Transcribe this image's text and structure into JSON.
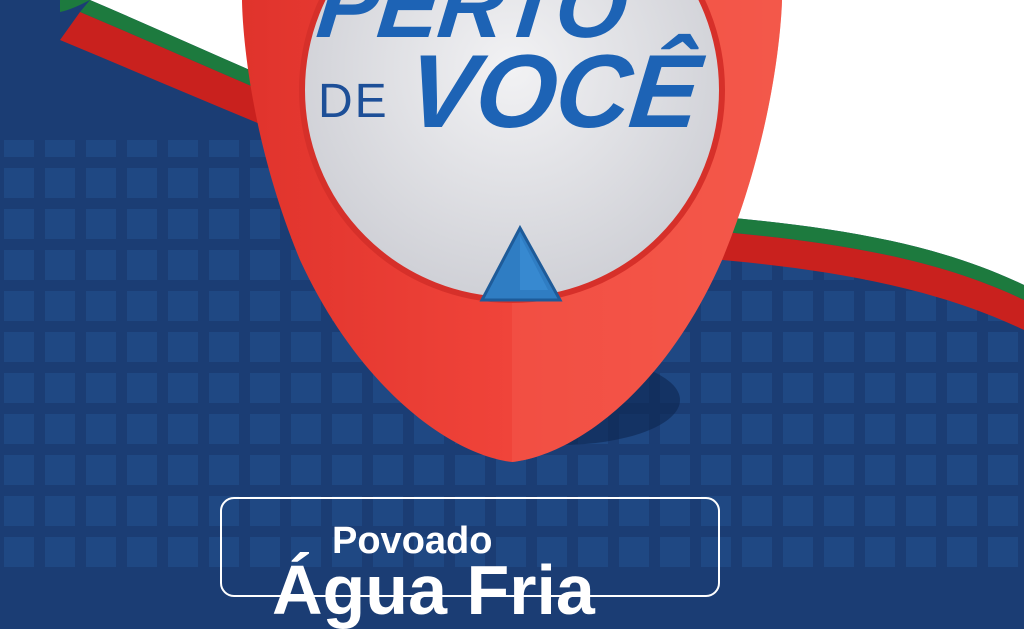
{
  "headline": {
    "line1": "PERTO",
    "line2_prefix": "DE",
    "line2": "VOCÊ"
  },
  "location": {
    "label": "Povoado",
    "name": "Água Fria"
  },
  "colors": {
    "background": "#1b3d74",
    "pin_red": "#f0443a",
    "stripe_green": "#1d7a3e",
    "stripe_red": "#c9211e",
    "headline_blue": "#1d63b5"
  },
  "icons": {
    "pin": "map-pin-icon",
    "triangle": "triangle-marker-icon"
  }
}
